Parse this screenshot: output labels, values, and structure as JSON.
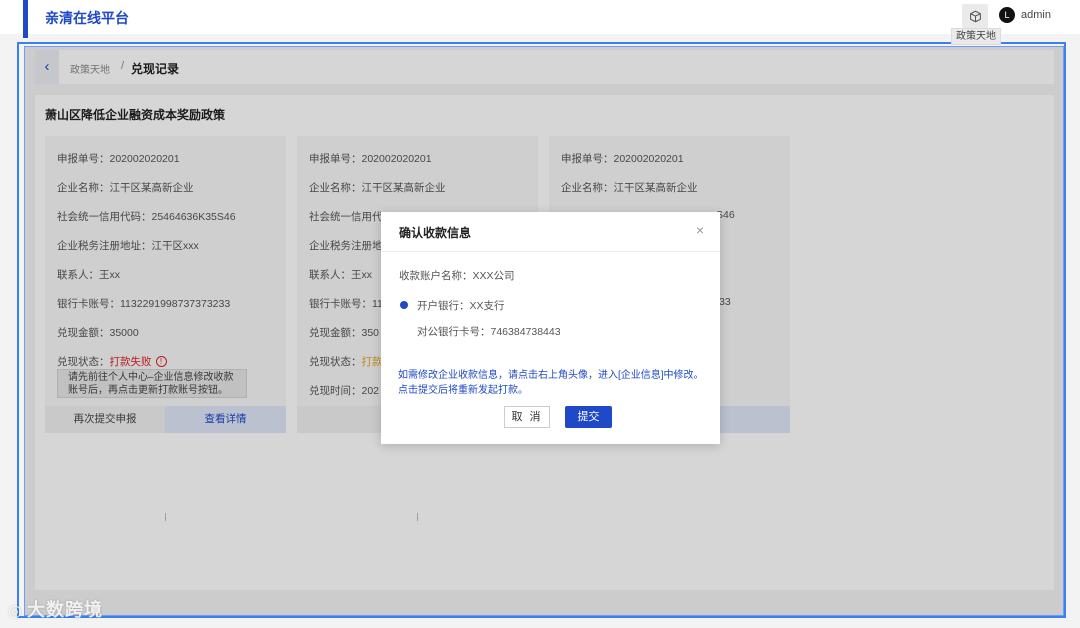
{
  "app": {
    "brand": "亲清在线平台",
    "policy_tooltip": "政策天地",
    "avatar_letter": "L",
    "username": "admin"
  },
  "breadcrumb": {
    "parent": "政策天地",
    "separator": "/",
    "current": "兑现记录"
  },
  "panel": {
    "title": "萧山区降低企业融资成本奖励政策"
  },
  "cards": [
    {
      "report_no": "申报单号：202002020201",
      "company": "企业名称：江干区某高新企业",
      "credit_code": "社会统一信用代码：25464636K35S46",
      "tax_addr": "企业税务注册地址：江干区xxx",
      "contact": "联系人：王xx",
      "bank_card": "银行卡账号：1132291998737373233",
      "amount": "兑现金额：35000",
      "status_label": "兑现状态：",
      "status_value": "打款失败",
      "hint": "请先前往个人中心–企业信息修改收款账号后，再点击更新打款账号按钮。",
      "action_left": "再次提交申报",
      "action_right": "查看详情"
    },
    {
      "report_no": "申报单号：202002020201",
      "company": "企业名称：江干区某高新企业",
      "credit_code": "社会统一信用代",
      "tax_addr": "企业税务注册地",
      "contact": "联系人：王xx",
      "bank_card": "银行卡账号：11",
      "amount": "兑现金额：350",
      "status_label": "兑现状态：",
      "status_value": "打款",
      "time": "兑现时间：202"
    },
    {
      "report_no": "申报单号：202002020201",
      "company": "企业名称：江干区某高新企业",
      "credit_code_tail": "S46",
      "bank_tail": "33"
    }
  ],
  "modal": {
    "title": "确认收款信息",
    "close_glyph": "×",
    "account_name": "收款账户名称：XXX公司",
    "bank": "开户银行：XX支行",
    "card_no": "对公银行卡号：746384738443",
    "notice": "如需修改企业收款信息，请点击右上角头像，进入[企业信息]中修改。点击提交后将重新发起打款。",
    "cancel": "取 消",
    "submit": "提交"
  },
  "watermark": {
    "text": "大数跨境"
  },
  "colors": {
    "brand": "#1f49c7",
    "fail": "#e02020",
    "pending": "#e8a31a"
  }
}
